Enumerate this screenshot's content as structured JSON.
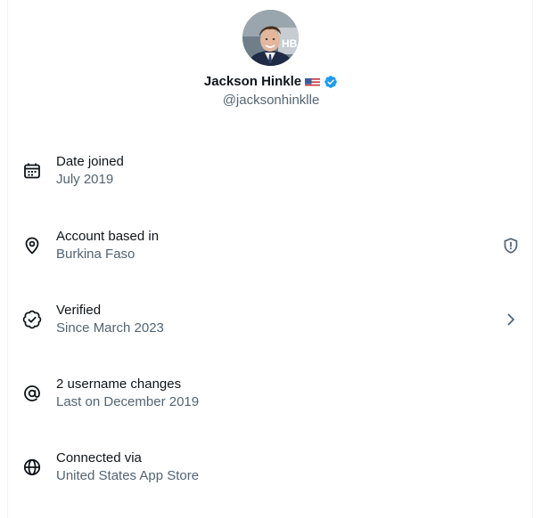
{
  "profile": {
    "name": "Jackson Hinkle",
    "flag_icon": "us-flag-icon",
    "verified_icon": "verified-badge-icon",
    "verified_color": "#1d9bf0",
    "handle": "@jacksonhinklle",
    "avatar_icon": "profile-photo"
  },
  "about": {
    "items": [
      {
        "icon": "calendar-icon",
        "title": "Date joined",
        "subtitle": "July 2019"
      },
      {
        "icon": "location-pin-icon",
        "title": "Account based in",
        "subtitle": "Burkina Faso",
        "trailing_icon": "shield-alert-icon"
      },
      {
        "icon": "verified-check-icon",
        "title": "Verified",
        "subtitle": "Since March 2023",
        "trailing_icon": "chevron-right-icon"
      },
      {
        "icon": "at-sign-icon",
        "title": "2 username changes",
        "subtitle": "Last on December 2019"
      },
      {
        "icon": "globe-icon",
        "title": "Connected via",
        "subtitle": "United States App Store"
      }
    ]
  },
  "colors": {
    "primary_text": "#0f1419",
    "secondary_text": "#536471",
    "accent": "#1d9bf0"
  }
}
